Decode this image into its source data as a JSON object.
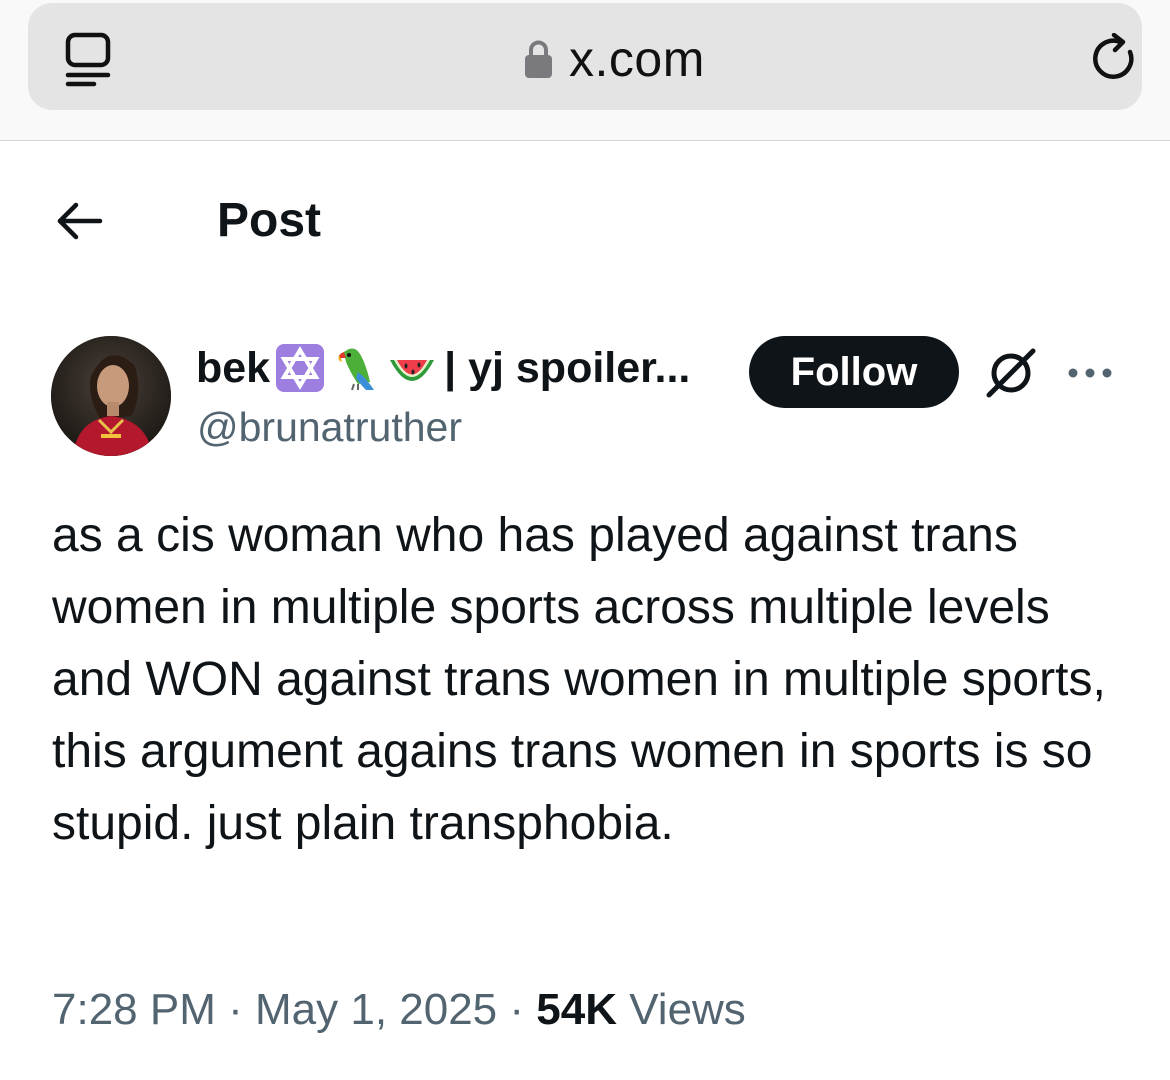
{
  "browser": {
    "url": "x.com",
    "tabs_icon": "tabs-icon",
    "lock_icon": "lock-icon",
    "reload_icon": "reload-icon"
  },
  "header": {
    "back_icon": "back-arrow-icon",
    "title": "Post"
  },
  "author": {
    "name": "bek",
    "emojis": [
      "star-of-david-emoji",
      "parrot-emoji",
      "watermelon-emoji"
    ],
    "name_suffix": "| yj spoiler...",
    "handle": "@brunatruther",
    "follow_label": "Follow"
  },
  "tweet": {
    "text": "as a cis woman who has played against trans women in multiple sports across multiple levels and WON against trans women in multiple sports, this argument agains trans women in sports is so stupid. just plain transphobia.",
    "time": "7:28 PM",
    "separator": "·",
    "date": "May 1, 2025",
    "views_count": "54K",
    "views_label": "Views"
  },
  "colors": {
    "text_primary": "#0f1419",
    "text_secondary": "#536471",
    "follow_bg": "#0f1419",
    "url_bar_bg": "#e4e4e5"
  }
}
